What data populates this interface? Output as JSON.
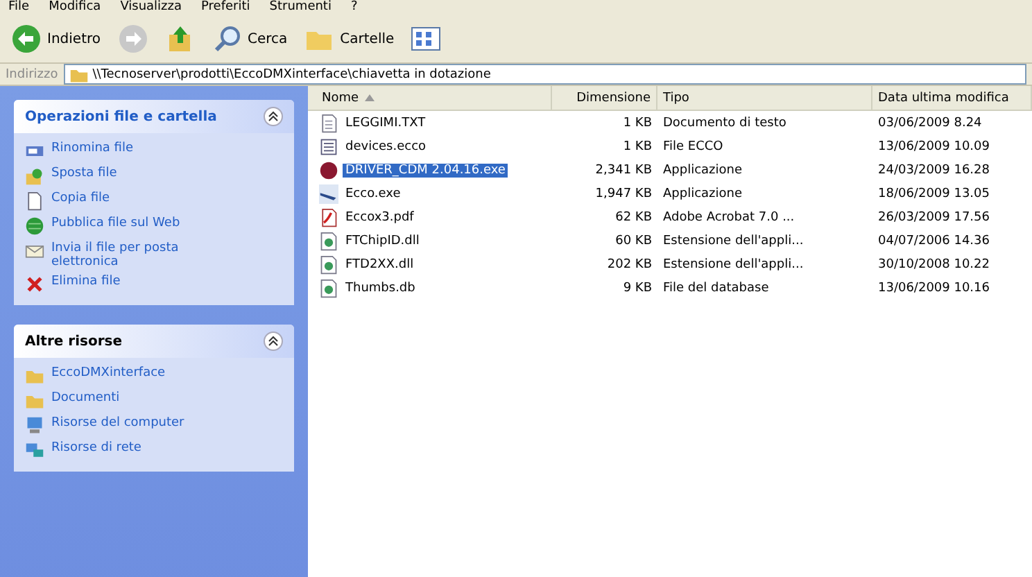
{
  "menu_bar": [
    "File",
    "Modifica",
    "Visualizza",
    "Preferiti",
    "Strumenti",
    "?"
  ],
  "toolbar": [
    {
      "kind": "back",
      "label": "Indietro"
    },
    {
      "kind": "forward"
    },
    {
      "kind": "up"
    },
    {
      "kind": "search",
      "label": "Cerca"
    },
    {
      "kind": "folders",
      "label": "Cartelle"
    },
    {
      "kind": "views"
    }
  ],
  "address_bar": {
    "label": "Indirizzo",
    "value": "\\\\Tecnoserver\\prodotti\\EccoDMXinterface\\chiavetta in dotazione"
  },
  "task_panels": [
    {
      "title": "Operazioni file e cartella",
      "expanded": true,
      "items": [
        {
          "kind": "rename",
          "label": "Rinomina file"
        },
        {
          "kind": "move",
          "label": "Sposta file"
        },
        {
          "kind": "copy",
          "label": "Copia file"
        },
        {
          "kind": "web",
          "label": "Pubblica file sul Web"
        },
        {
          "kind": "mail",
          "label": "Invia il file per posta elettronica"
        },
        {
          "kind": "delete",
          "label": "Elimina file"
        }
      ]
    },
    {
      "title": "Altre risorse",
      "expanded": true,
      "items": [
        {
          "kind": "folder",
          "label": "EccoDMXinterface"
        },
        {
          "kind": "folder",
          "label": "Documenti"
        },
        {
          "kind": "computer",
          "label": "Risorse del computer"
        },
        {
          "kind": "network",
          "label": "Risorse di rete"
        }
      ]
    }
  ],
  "table": {
    "columns": [
      "Nome",
      "Dimensione",
      "Tipo",
      "Data ultima modifica"
    ],
    "rows": [
      {
        "kind": "text",
        "name": "LEGGIMI.TXT",
        "size": "1 KB",
        "type": "Documento di testo",
        "date": "03/06/2009 8.24",
        "selected": false
      },
      {
        "kind": "doc",
        "name": "devices.ecco",
        "size": "1 KB",
        "type": "File ECCO",
        "date": "13/06/2009 10.09",
        "selected": false
      },
      {
        "kind": "installer",
        "name": "DRIVER_CDM 2.04.16.exe",
        "size": "2,341 KB",
        "type": "Applicazione",
        "date": "24/03/2009 16.28",
        "selected": true
      },
      {
        "kind": "exe",
        "name": "Ecco.exe",
        "size": "1,947 KB",
        "type": "Applicazione",
        "date": "18/06/2009 13.05",
        "selected": false
      },
      {
        "kind": "pdf",
        "name": "Eccox3.pdf",
        "size": "62 KB",
        "type": "Adobe Acrobat 7.0 ...",
        "date": "26/03/2009 17.56",
        "selected": false
      },
      {
        "kind": "dll",
        "name": "FTChipID.dll",
        "size": "60 KB",
        "type": "Estensione dell'appli...",
        "date": "04/07/2006 14.36",
        "selected": false
      },
      {
        "kind": "dll",
        "name": "FTD2XX.dll",
        "size": "202 KB",
        "type": "Estensione dell'appli...",
        "date": "30/10/2008 10.22",
        "selected": false
      },
      {
        "kind": "dll",
        "name": "Thumbs.db",
        "size": "9 KB",
        "type": "File del database",
        "date": "13/06/2009 10.16",
        "selected": false
      }
    ]
  }
}
